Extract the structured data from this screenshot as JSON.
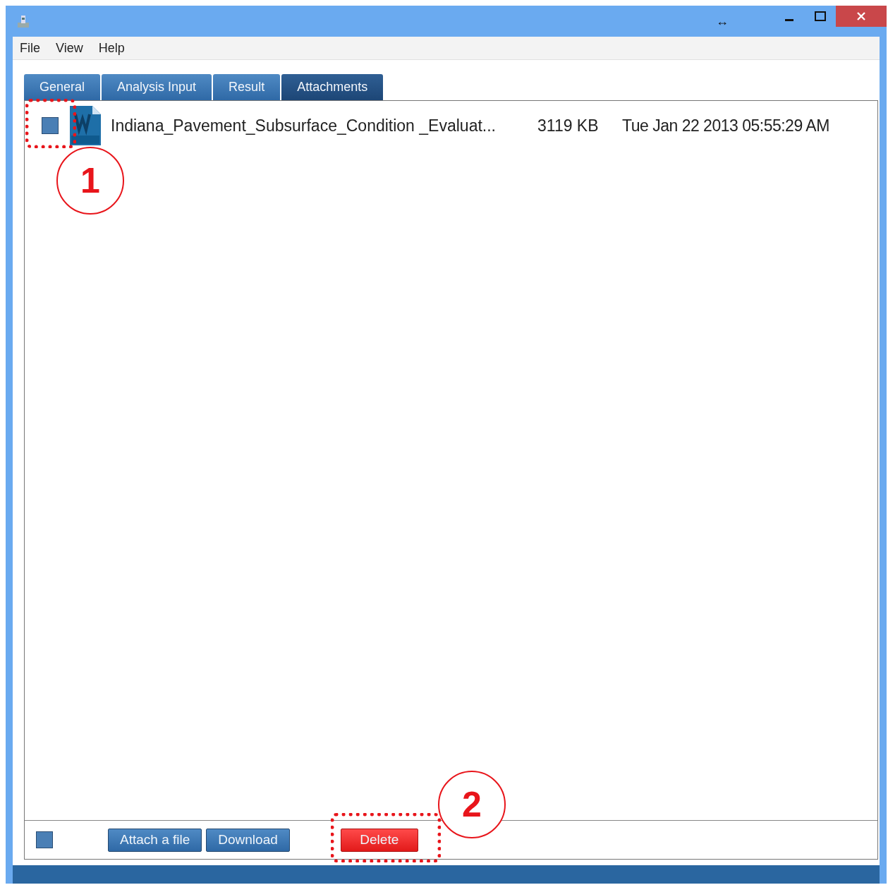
{
  "window": {
    "controls": [
      "↔"
    ]
  },
  "menu": [
    "File",
    "View",
    "Help"
  ],
  "tabs": [
    {
      "label": "General",
      "selected": false
    },
    {
      "label": "Analysis Input",
      "selected": false
    },
    {
      "label": "Result",
      "selected": false
    },
    {
      "label": "Attachments",
      "selected": true
    }
  ],
  "attachments": [
    {
      "checked": false,
      "name": "Indiana_Pavement_Subsurface_Condition _Evaluat...",
      "size": "3119 KB",
      "date": "Tue Jan 22 2013 05:55:29 AM"
    }
  ],
  "footer": {
    "select_all": {
      "checked": false
    },
    "buttons": [
      {
        "label": "Attach a file",
        "kind": "normal"
      },
      {
        "label": "Download",
        "kind": "normal"
      },
      {
        "label": "Delete",
        "kind": "danger"
      }
    ]
  },
  "callouts": [
    {
      "label": "1"
    },
    {
      "label": "2"
    }
  ]
}
